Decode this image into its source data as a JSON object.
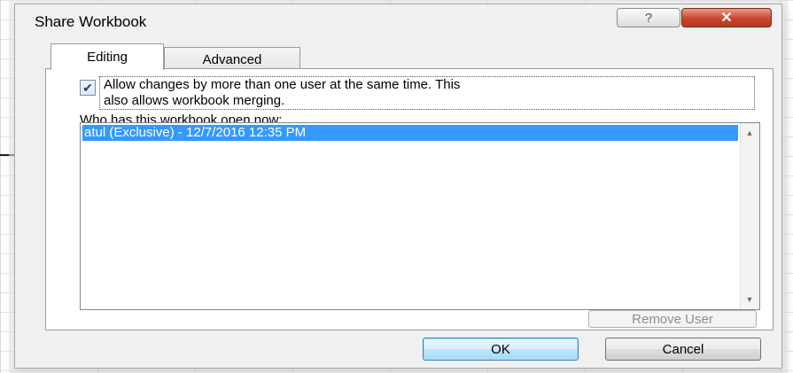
{
  "dialog": {
    "title": "Share Workbook",
    "help_glyph": "?",
    "close_glyph": "✕"
  },
  "tabs": [
    {
      "label": "Editing",
      "selected": true
    },
    {
      "label": "Advanced",
      "selected": false
    }
  ],
  "editing": {
    "allow_changes_checked": true,
    "allow_changes_line1": "Allow changes by more than one user at the same time.  This",
    "allow_changes_line2": "also allows workbook merging.",
    "who_label": "Who has this workbook open now:",
    "users": [
      "atul (Exclusive) - 12/7/2016 12:35 PM"
    ],
    "remove_user_label": "Remove User",
    "remove_user_enabled": false
  },
  "buttons": {
    "ok_label": "OK",
    "cancel_label": "Cancel"
  },
  "colors": {
    "selection": "#3399ff",
    "close_button": "#c8452e"
  },
  "icons": {
    "help": "help-icon",
    "close": "close-icon",
    "check": "checkmark-icon",
    "scroll_up": "chevron-up-icon",
    "scroll_down": "chevron-down-icon"
  }
}
